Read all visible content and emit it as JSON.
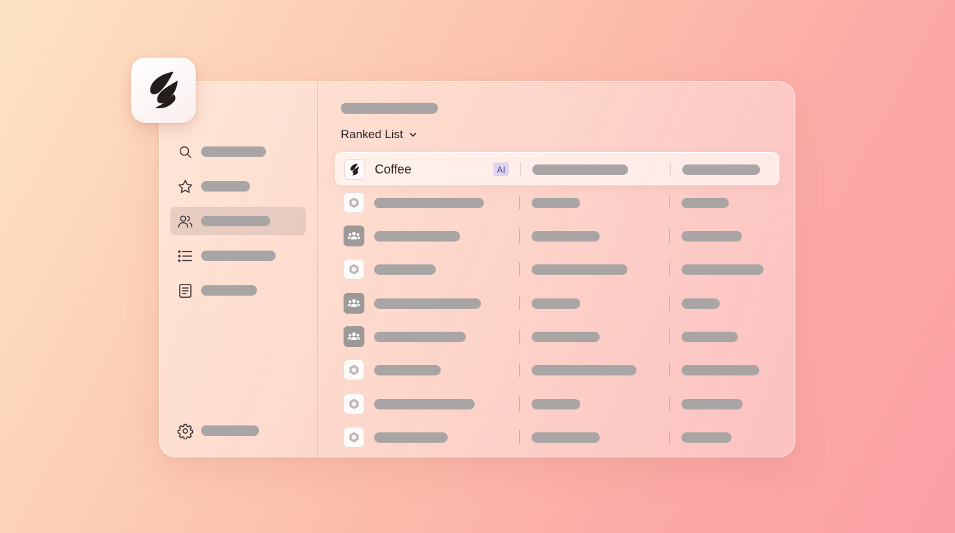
{
  "list_selector": {
    "label": "Ranked List",
    "icon": "chevron-down-icon"
  },
  "highlighted_row": {
    "name": "Coffee",
    "badge": "AI"
  },
  "sidebar": {
    "items": [
      {
        "icon": "search-icon",
        "active": false
      },
      {
        "icon": "star-icon",
        "active": false
      },
      {
        "icon": "users-icon",
        "active": true
      },
      {
        "icon": "list-icon",
        "active": false
      },
      {
        "icon": "document-icon",
        "active": false
      }
    ],
    "footer": {
      "icon": "gear-icon"
    }
  },
  "rows": [
    {
      "icon": "coffee-bean-icon",
      "name": "Coffee",
      "badge": "AI"
    },
    {
      "icon": "hexagon-icon"
    },
    {
      "icon": "group-icon"
    },
    {
      "icon": "hexagon-icon"
    },
    {
      "icon": "group-icon"
    },
    {
      "icon": "group-icon"
    },
    {
      "icon": "hexagon-icon"
    },
    {
      "icon": "hexagon-icon"
    },
    {
      "icon": "hexagon-icon"
    }
  ],
  "colors": {
    "placeholder": "#a9a5a5",
    "ai_badge_bg": "#dfd3ef",
    "ai_badge_text": "#5a4f86",
    "active_nav": "#cdb2ac"
  }
}
